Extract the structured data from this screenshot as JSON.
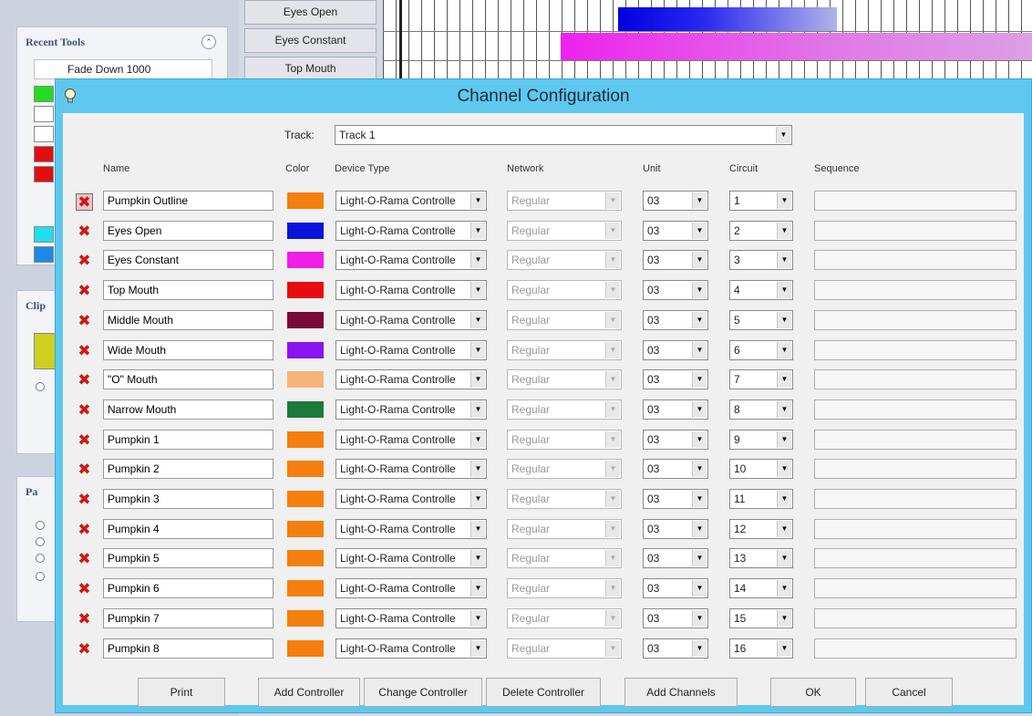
{
  "background": {
    "recent_tools_title": "Recent Tools",
    "fade_item": "Fade Down 1000",
    "clip_title": "Clip",
    "par_title": "Pa",
    "channel_list": [
      "Eyes Open",
      "Eyes Constant",
      "Top Mouth"
    ]
  },
  "dialog": {
    "title": "Channel Configuration",
    "track_label": "Track:",
    "track_value": "Track 1",
    "headers": {
      "name": "Name",
      "color": "Color",
      "device_type": "Device Type",
      "network": "Network",
      "unit": "Unit",
      "circuit": "Circuit",
      "sequence": "Sequence"
    },
    "channels": [
      {
        "name": "Pumpkin Outline",
        "color": "#f57f0e",
        "device": "Light-O-Rama Controlle",
        "network": "Regular",
        "unit": "03",
        "circuit": "1"
      },
      {
        "name": "Eyes Open",
        "color": "#0a14d9",
        "device": "Light-O-Rama Controlle",
        "network": "Regular",
        "unit": "03",
        "circuit": "2"
      },
      {
        "name": "Eyes Constant",
        "color": "#f01ee6",
        "device": "Light-O-Rama Controlle",
        "network": "Regular",
        "unit": "03",
        "circuit": "3"
      },
      {
        "name": "Top Mouth",
        "color": "#e80c12",
        "device": "Light-O-Rama Controlle",
        "network": "Regular",
        "unit": "03",
        "circuit": "4"
      },
      {
        "name": "Middle Mouth",
        "color": "#7a0a3a",
        "device": "Light-O-Rama Controlle",
        "network": "Regular",
        "unit": "03",
        "circuit": "5"
      },
      {
        "name": "Wide Mouth",
        "color": "#8a14ec",
        "device": "Light-O-Rama Controlle",
        "network": "Regular",
        "unit": "03",
        "circuit": "6"
      },
      {
        "name": "\"O\" Mouth",
        "color": "#f7b47a",
        "device": "Light-O-Rama Controlle",
        "network": "Regular",
        "unit": "03",
        "circuit": "7"
      },
      {
        "name": "Narrow Mouth",
        "color": "#1d7a3a",
        "device": "Light-O-Rama Controlle",
        "network": "Regular",
        "unit": "03",
        "circuit": "8"
      },
      {
        "name": "Pumpkin 1",
        "color": "#f57f0e",
        "device": "Light-O-Rama Controlle",
        "network": "Regular",
        "unit": "03",
        "circuit": "9"
      },
      {
        "name": "Pumpkin 2",
        "color": "#f57f0e",
        "device": "Light-O-Rama Controlle",
        "network": "Regular",
        "unit": "03",
        "circuit": "10"
      },
      {
        "name": "Pumpkin 3",
        "color": "#f57f0e",
        "device": "Light-O-Rama Controlle",
        "network": "Regular",
        "unit": "03",
        "circuit": "11"
      },
      {
        "name": "Pumpkin 4",
        "color": "#f57f0e",
        "device": "Light-O-Rama Controlle",
        "network": "Regular",
        "unit": "03",
        "circuit": "12"
      },
      {
        "name": "Pumpkin 5",
        "color": "#f57f0e",
        "device": "Light-O-Rama Controlle",
        "network": "Regular",
        "unit": "03",
        "circuit": "13"
      },
      {
        "name": "Pumpkin 6",
        "color": "#f57f0e",
        "device": "Light-O-Rama Controlle",
        "network": "Regular",
        "unit": "03",
        "circuit": "14"
      },
      {
        "name": "Pumpkin 7",
        "color": "#f57f0e",
        "device": "Light-O-Rama Controlle",
        "network": "Regular",
        "unit": "03",
        "circuit": "15"
      },
      {
        "name": "Pumpkin 8",
        "color": "#f57f0e",
        "device": "Light-O-Rama Controlle",
        "network": "Regular",
        "unit": "03",
        "circuit": "16"
      }
    ],
    "buttons": {
      "print": "Print",
      "add_controller": "Add Controller",
      "change_controller": "Change Controller",
      "delete_controller": "Delete Controller",
      "add_channels": "Add Channels",
      "ok": "OK",
      "cancel": "Cancel"
    },
    "delete_glyph": "✖",
    "dropdown_glyph": "▼"
  },
  "colors": {
    "dialog_frame": "#5fc8ee",
    "delete_red": "#d01818"
  }
}
